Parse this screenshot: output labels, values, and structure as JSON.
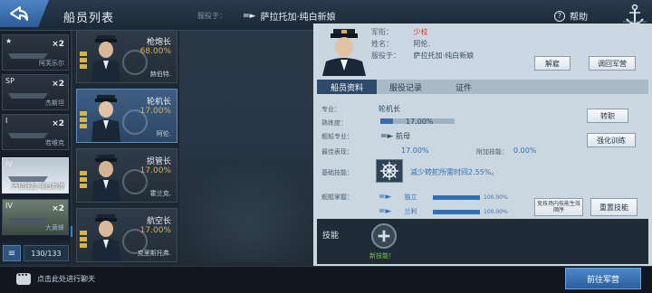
{
  "header": {
    "title": "船员列表",
    "serve_label": "服役于：",
    "serve_ship": "萨拉托加·纯白新娘",
    "help": "帮助"
  },
  "ship_strip": {
    "ships": [
      {
        "tier": "★",
        "count": "×2",
        "name": "阿芙乐尔"
      },
      {
        "tier": "SP",
        "count": "×2",
        "name": "杰斯坦"
      },
      {
        "tier": "I",
        "count": "×2",
        "name": "若维克"
      },
      {
        "tier": "IV",
        "count": "",
        "name": "萨拉托加·纯白新娘"
      },
      {
        "tier": "IV",
        "count": "×2",
        "name": "大黄蜂"
      }
    ],
    "list_icon": "≡",
    "count": "130/133"
  },
  "crew_list": [
    {
      "role": "枪炮长",
      "pct": "68.00%",
      "name": "赫伯特."
    },
    {
      "role": "轮机长",
      "pct": "17.00%",
      "name": "阿伦."
    },
    {
      "role": "损管长",
      "pct": "17.00%",
      "name": "霍兰克."
    },
    {
      "role": "航空长",
      "pct": "17.00%",
      "name": "克里斯托弗."
    }
  ],
  "profile": {
    "rank_label": "军衔：",
    "rank_value": "少校",
    "name_label": "姓名：",
    "name_value": "阿伦.",
    "serve_label": "服役于：",
    "serve_value": "萨拉托加·纯白新娘",
    "dismiss_btn": "解雇",
    "return_btn": "调回军营"
  },
  "tabs": [
    "船员资料",
    "服役记录",
    "证件"
  ],
  "details": {
    "specialty_label": "专业：",
    "specialty_value": "轮机长",
    "proficiency_label": "熟练度：",
    "proficiency_value": "17.00%",
    "proficiency_fill": 0.17,
    "ship_spec_label": "舰船专业：",
    "ship_spec_value": "航母",
    "best_perf_label": "最佳表现：",
    "best_perf_value": "17.00%",
    "extra_skill_label": "附加技能：",
    "extra_skill_value": "0.00%",
    "base_skill_label": "基础技能：",
    "base_skill_value": "减少转舵所需时间2.55%。",
    "ship_mastery_label": "舰艇掌握：",
    "transfer_btn": "转职",
    "train_btn": "强化训练",
    "skill_order_btn": "竞技场内技能生效顺序",
    "reset_btn": "重置技能",
    "mastery": [
      {
        "name": "独立",
        "pct": "100.00%",
        "fill": 1.0
      },
      {
        "name": "兰利",
        "pct": "100.00%",
        "fill": 1.0
      }
    ]
  },
  "skills": {
    "label": "技能",
    "new_skill": "新技能！"
  },
  "bottom": {
    "chat": "点击此处进行聊天",
    "go_base": "前往军营"
  },
  "colors": {
    "accent_blue": "#2d4a6a",
    "rank_red": "#d23a2b",
    "pct_gold": "#e0b03c",
    "new_green": "#74c63f"
  }
}
